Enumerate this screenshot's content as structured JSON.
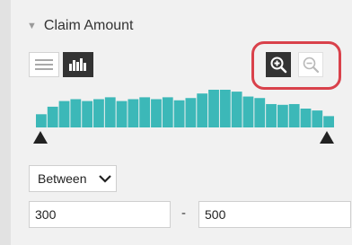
{
  "section": {
    "title": "Claim Amount",
    "caret": "▼"
  },
  "views": {
    "list_icon": "list-view-icon",
    "histogram_icon": "histogram-view-icon"
  },
  "zoom": {
    "in_icon": "zoom-in-icon",
    "out_icon": "zoom-out-icon"
  },
  "histogram": {
    "bar_color": "#3cb8b8",
    "relative_heights": [
      0.35,
      0.55,
      0.7,
      0.75,
      0.7,
      0.75,
      0.8,
      0.7,
      0.75,
      0.8,
      0.75,
      0.8,
      0.72,
      0.78,
      0.9,
      1.0,
      1.0,
      0.95,
      0.82,
      0.78,
      0.62,
      0.6,
      0.62,
      0.5,
      0.45,
      0.3
    ]
  },
  "filter": {
    "operator": "Between",
    "min_value": "300",
    "max_value": "500",
    "separator": "-"
  },
  "colors": {
    "highlight": "#d9414b",
    "dark": "#333333",
    "teal": "#3cb8b8"
  }
}
